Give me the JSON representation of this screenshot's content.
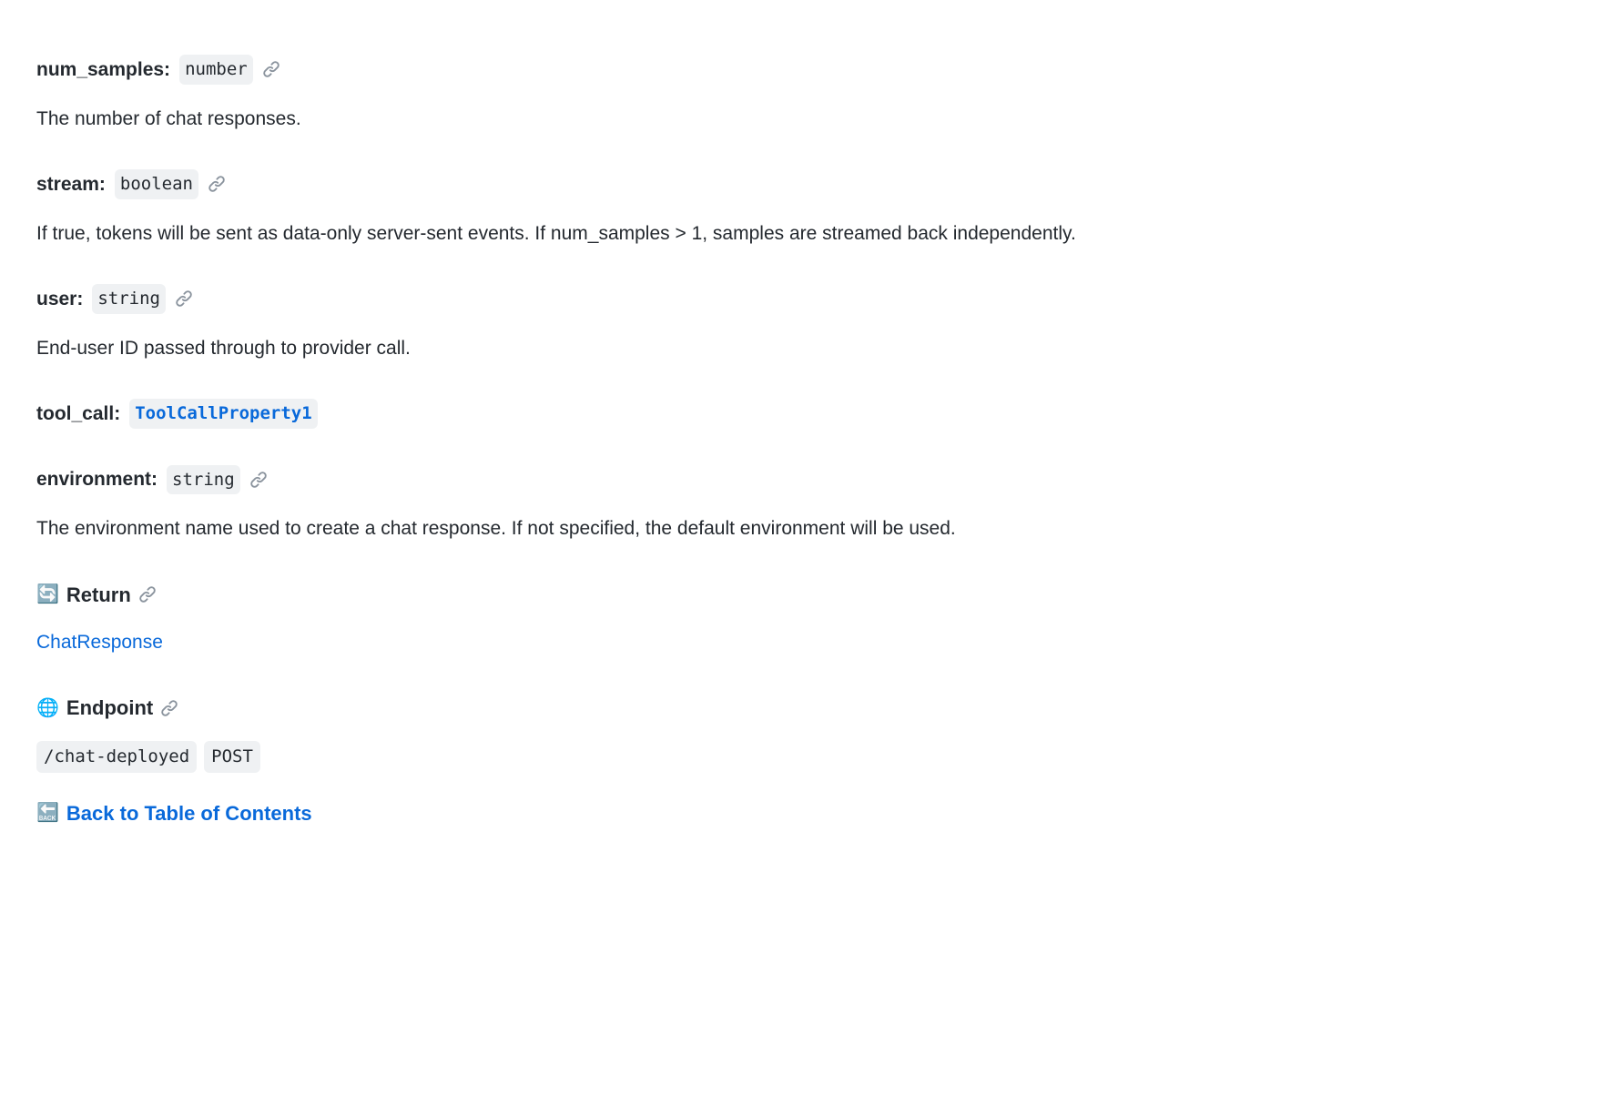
{
  "params": {
    "num_samples": {
      "name": "num_samples:",
      "type": "number",
      "description": "The number of chat responses."
    },
    "stream": {
      "name": "stream:",
      "type": "boolean",
      "description": "If true, tokens will be sent as data-only server-sent events. If num_samples > 1, samples are streamed back independently."
    },
    "user": {
      "name": "user:",
      "type": "string",
      "description": "End-user ID passed through to provider call."
    },
    "tool_call": {
      "name": "tool_call:",
      "type_link": "ToolCallProperty1"
    },
    "environment": {
      "name": "environment:",
      "type": "string",
      "description": "The environment name used to create a chat response. If not specified, the default environment will be used."
    }
  },
  "return_section": {
    "icon": "🔄",
    "title": "Return",
    "link_text": "ChatResponse"
  },
  "endpoint_section": {
    "icon": "🌐",
    "title": "Endpoint",
    "path": "/chat-deployed",
    "method": "POST"
  },
  "back_link": {
    "text": "Back to Table of Contents"
  }
}
